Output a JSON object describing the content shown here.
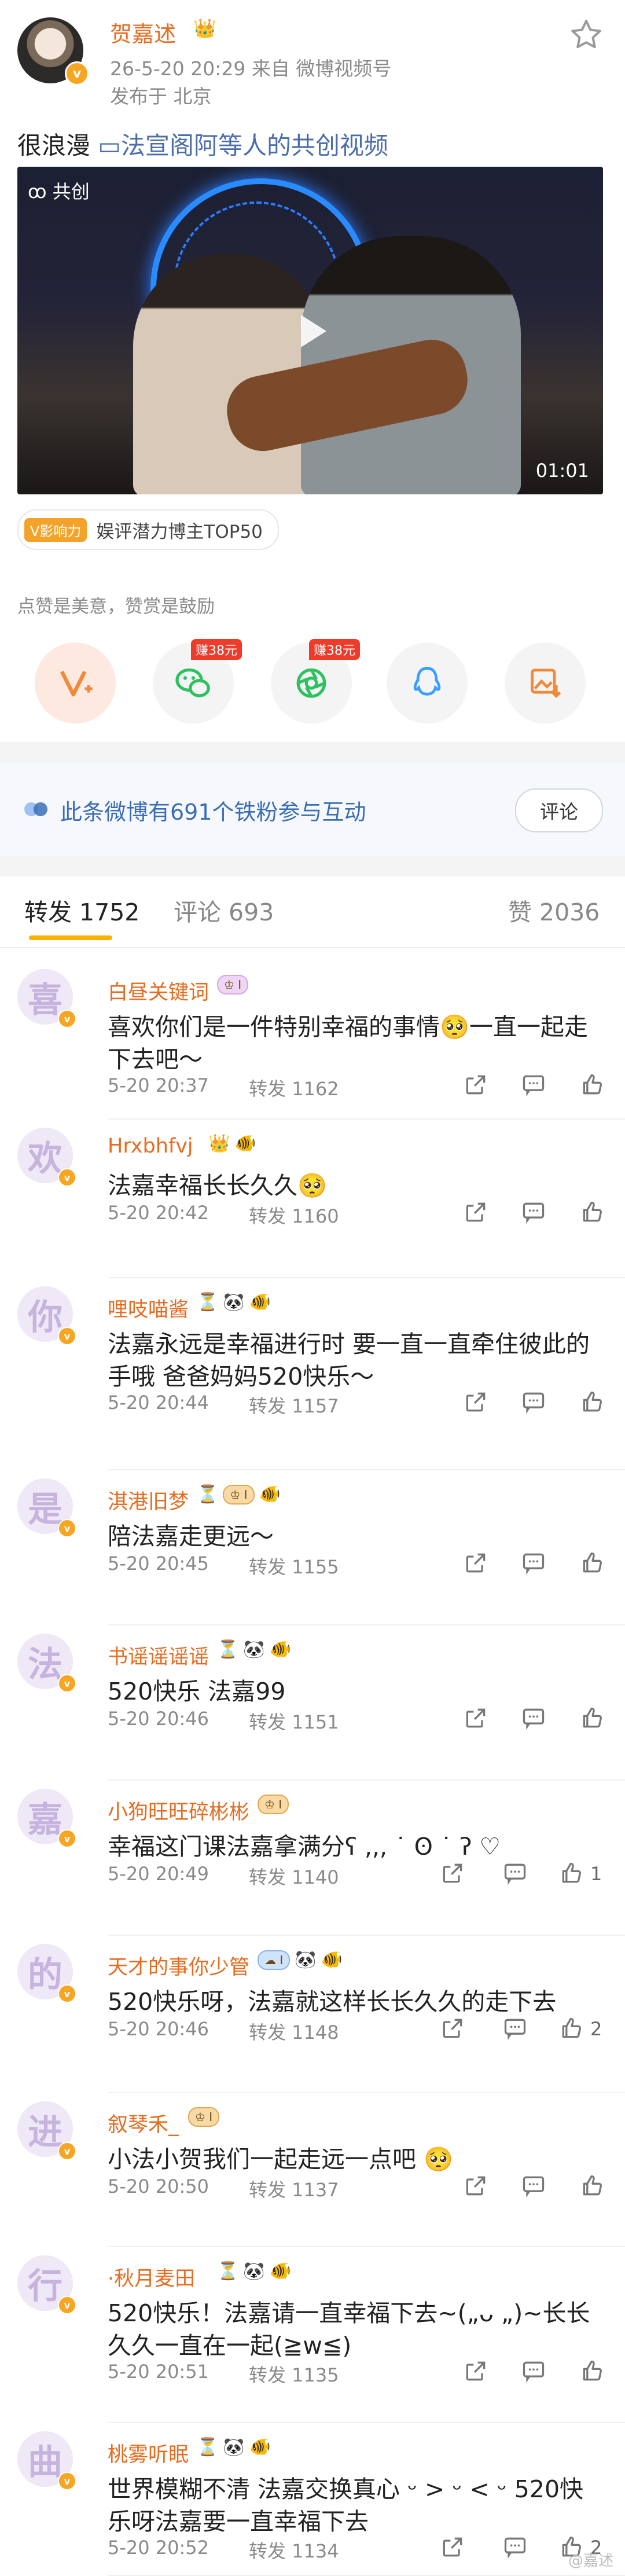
{
  "post": {
    "author": "贺嘉述",
    "crown": "👑",
    "verified": "v",
    "time_source": "26-5-20 20:29  来自 微博视频号",
    "location": "发布于 北京",
    "text_plain": "很浪漫 ",
    "text_link": "法宣阁阿等人的共创视频",
    "video": {
      "badge": "共创",
      "duration": "01:01"
    },
    "tag": {
      "badge": "V影响力",
      "label": "娱评潜力博主TOP50"
    }
  },
  "reward_text": "点赞是美意，赞赏是鼓励",
  "share": {
    "earn1": "赚38元",
    "earn2": "赚38元"
  },
  "fans_bar": {
    "text": "此条微博有691个铁粉参与互动",
    "button": "评论"
  },
  "tabs": {
    "repost": "转发 1752",
    "comment": "评论 693",
    "like": "赞 2036"
  },
  "watermark": "@嘉述",
  "comments": [
    {
      "avatar": "喜",
      "name": "白昼关键词",
      "badges": [
        {
          "t": "chip purple",
          "v": "♔ I"
        }
      ],
      "text": "喜欢你们是一件特别幸福的事情🥺一直一起走下去吧～",
      "time": "5-20 20:37",
      "repost": "转发 1162",
      "like": ""
    },
    {
      "avatar": "欢",
      "name": "Hrxbhfvj",
      "badges": [
        {
          "t": "emo",
          "v": "👑"
        },
        {
          "t": "emo",
          "v": "🐠"
        }
      ],
      "text": "法嘉幸福长长久久🥺",
      "time": "5-20 20:42",
      "repost": "转发 1160",
      "like": ""
    },
    {
      "avatar": "你",
      "name": "哩吱喵酱",
      "badges": [
        {
          "t": "emo",
          "v": "⏳"
        },
        {
          "t": "emo",
          "v": "🐼"
        },
        {
          "t": "emo",
          "v": "🐠"
        }
      ],
      "text": "法嘉永远是幸福进行时 要一直一直牵住彼此的手哦 爸爸妈妈520快乐～",
      "time": "5-20 20:44",
      "repost": "转发 1157",
      "like": ""
    },
    {
      "avatar": "是",
      "name": "淇港旧梦",
      "badges": [
        {
          "t": "emo",
          "v": "⏳"
        },
        {
          "t": "chip",
          "v": "♔ I"
        },
        {
          "t": "emo",
          "v": "🐠"
        }
      ],
      "text": "陪法嘉走更远～",
      "time": "5-20 20:45",
      "repost": "转发 1155",
      "like": ""
    },
    {
      "avatar": "法",
      "name": "书谣谣谣谣",
      "badges": [
        {
          "t": "emo",
          "v": "⏳"
        },
        {
          "t": "emo",
          "v": "🐼"
        },
        {
          "t": "emo",
          "v": "🐠"
        }
      ],
      "text": "520快乐 法嘉99",
      "time": "5-20 20:46",
      "repost": "转发 1151",
      "like": ""
    },
    {
      "avatar": "嘉",
      "name": "小狗旺旺碎彬彬",
      "badges": [
        {
          "t": "chip",
          "v": "♔ I"
        }
      ],
      "text": "幸福这门课法嘉拿满分ʕ ,,, ˙ ʘ ˙ ʔ ♡",
      "time": "5-20 20:49",
      "repost": "转发 1140",
      "like": "1"
    },
    {
      "avatar": "的",
      "name": "天才的事你少管",
      "badges": [
        {
          "t": "chip blue",
          "v": "☁ I"
        },
        {
          "t": "emo",
          "v": "🐼"
        },
        {
          "t": "emo",
          "v": "🐠"
        }
      ],
      "text": "520快乐呀，法嘉就这样长长久久的走下去",
      "time": "5-20 20:46",
      "repost": "转发 1148",
      "like": "2"
    },
    {
      "avatar": "进",
      "name": "叙琴禾_",
      "badges": [
        {
          "t": "chip",
          "v": "♔ I"
        }
      ],
      "text": "小法小贺我们一起走远一点吧 🥺",
      "time": "5-20 20:50",
      "repost": "转发 1137",
      "like": ""
    },
    {
      "avatar": "行",
      "name": "·秋月麦田",
      "badges": [
        {
          "t": "emo",
          "v": "⏳"
        },
        {
          "t": "emo",
          "v": "🐼"
        },
        {
          "t": "emo",
          "v": "🐠"
        }
      ],
      "text": "520快乐！法嘉请一直幸福下去~(„ᴗ „)~长长久久一直在一起(≧w≦)",
      "time": "5-20 20:51",
      "repost": "转发 1135",
      "like": ""
    },
    {
      "avatar": "曲",
      "name": "桃雾听眠",
      "badges": [
        {
          "t": "emo",
          "v": "⏳"
        },
        {
          "t": "emo",
          "v": "🐼"
        },
        {
          "t": "emo",
          "v": "🐠"
        }
      ],
      "text": "世界模糊不清 法嘉交换真心 ᵕ > ᵕ < ᵕ 520快乐呀法嘉要一直幸福下去",
      "time": "5-20 20:52",
      "repost": "转发 1134",
      "like": "2"
    }
  ]
}
